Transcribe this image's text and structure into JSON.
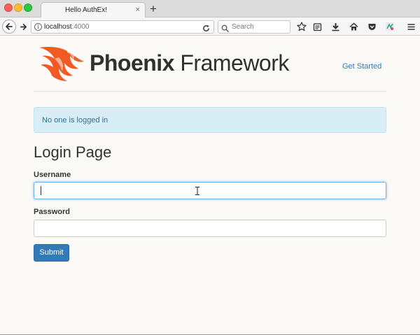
{
  "browser": {
    "tab_title": "Hello AuthEx!",
    "tab_close": "×",
    "new_tab": "+",
    "url_host": "localhost",
    "url_port": ":4000",
    "search_placeholder": "Search"
  },
  "header": {
    "logo_bold": "Phoenix",
    "logo_light": " Framework",
    "nav_link": "Get Started"
  },
  "alert": {
    "message": "No one is logged in"
  },
  "form": {
    "title": "Login Page",
    "username_label": "Username",
    "username_value": "",
    "password_label": "Password",
    "password_value": "",
    "submit_label": "Submit"
  },
  "colors": {
    "primary": "#337ab7",
    "alert_bg": "#d9edf7",
    "alert_text": "#31708f",
    "logo_orange": "#f15a24"
  }
}
